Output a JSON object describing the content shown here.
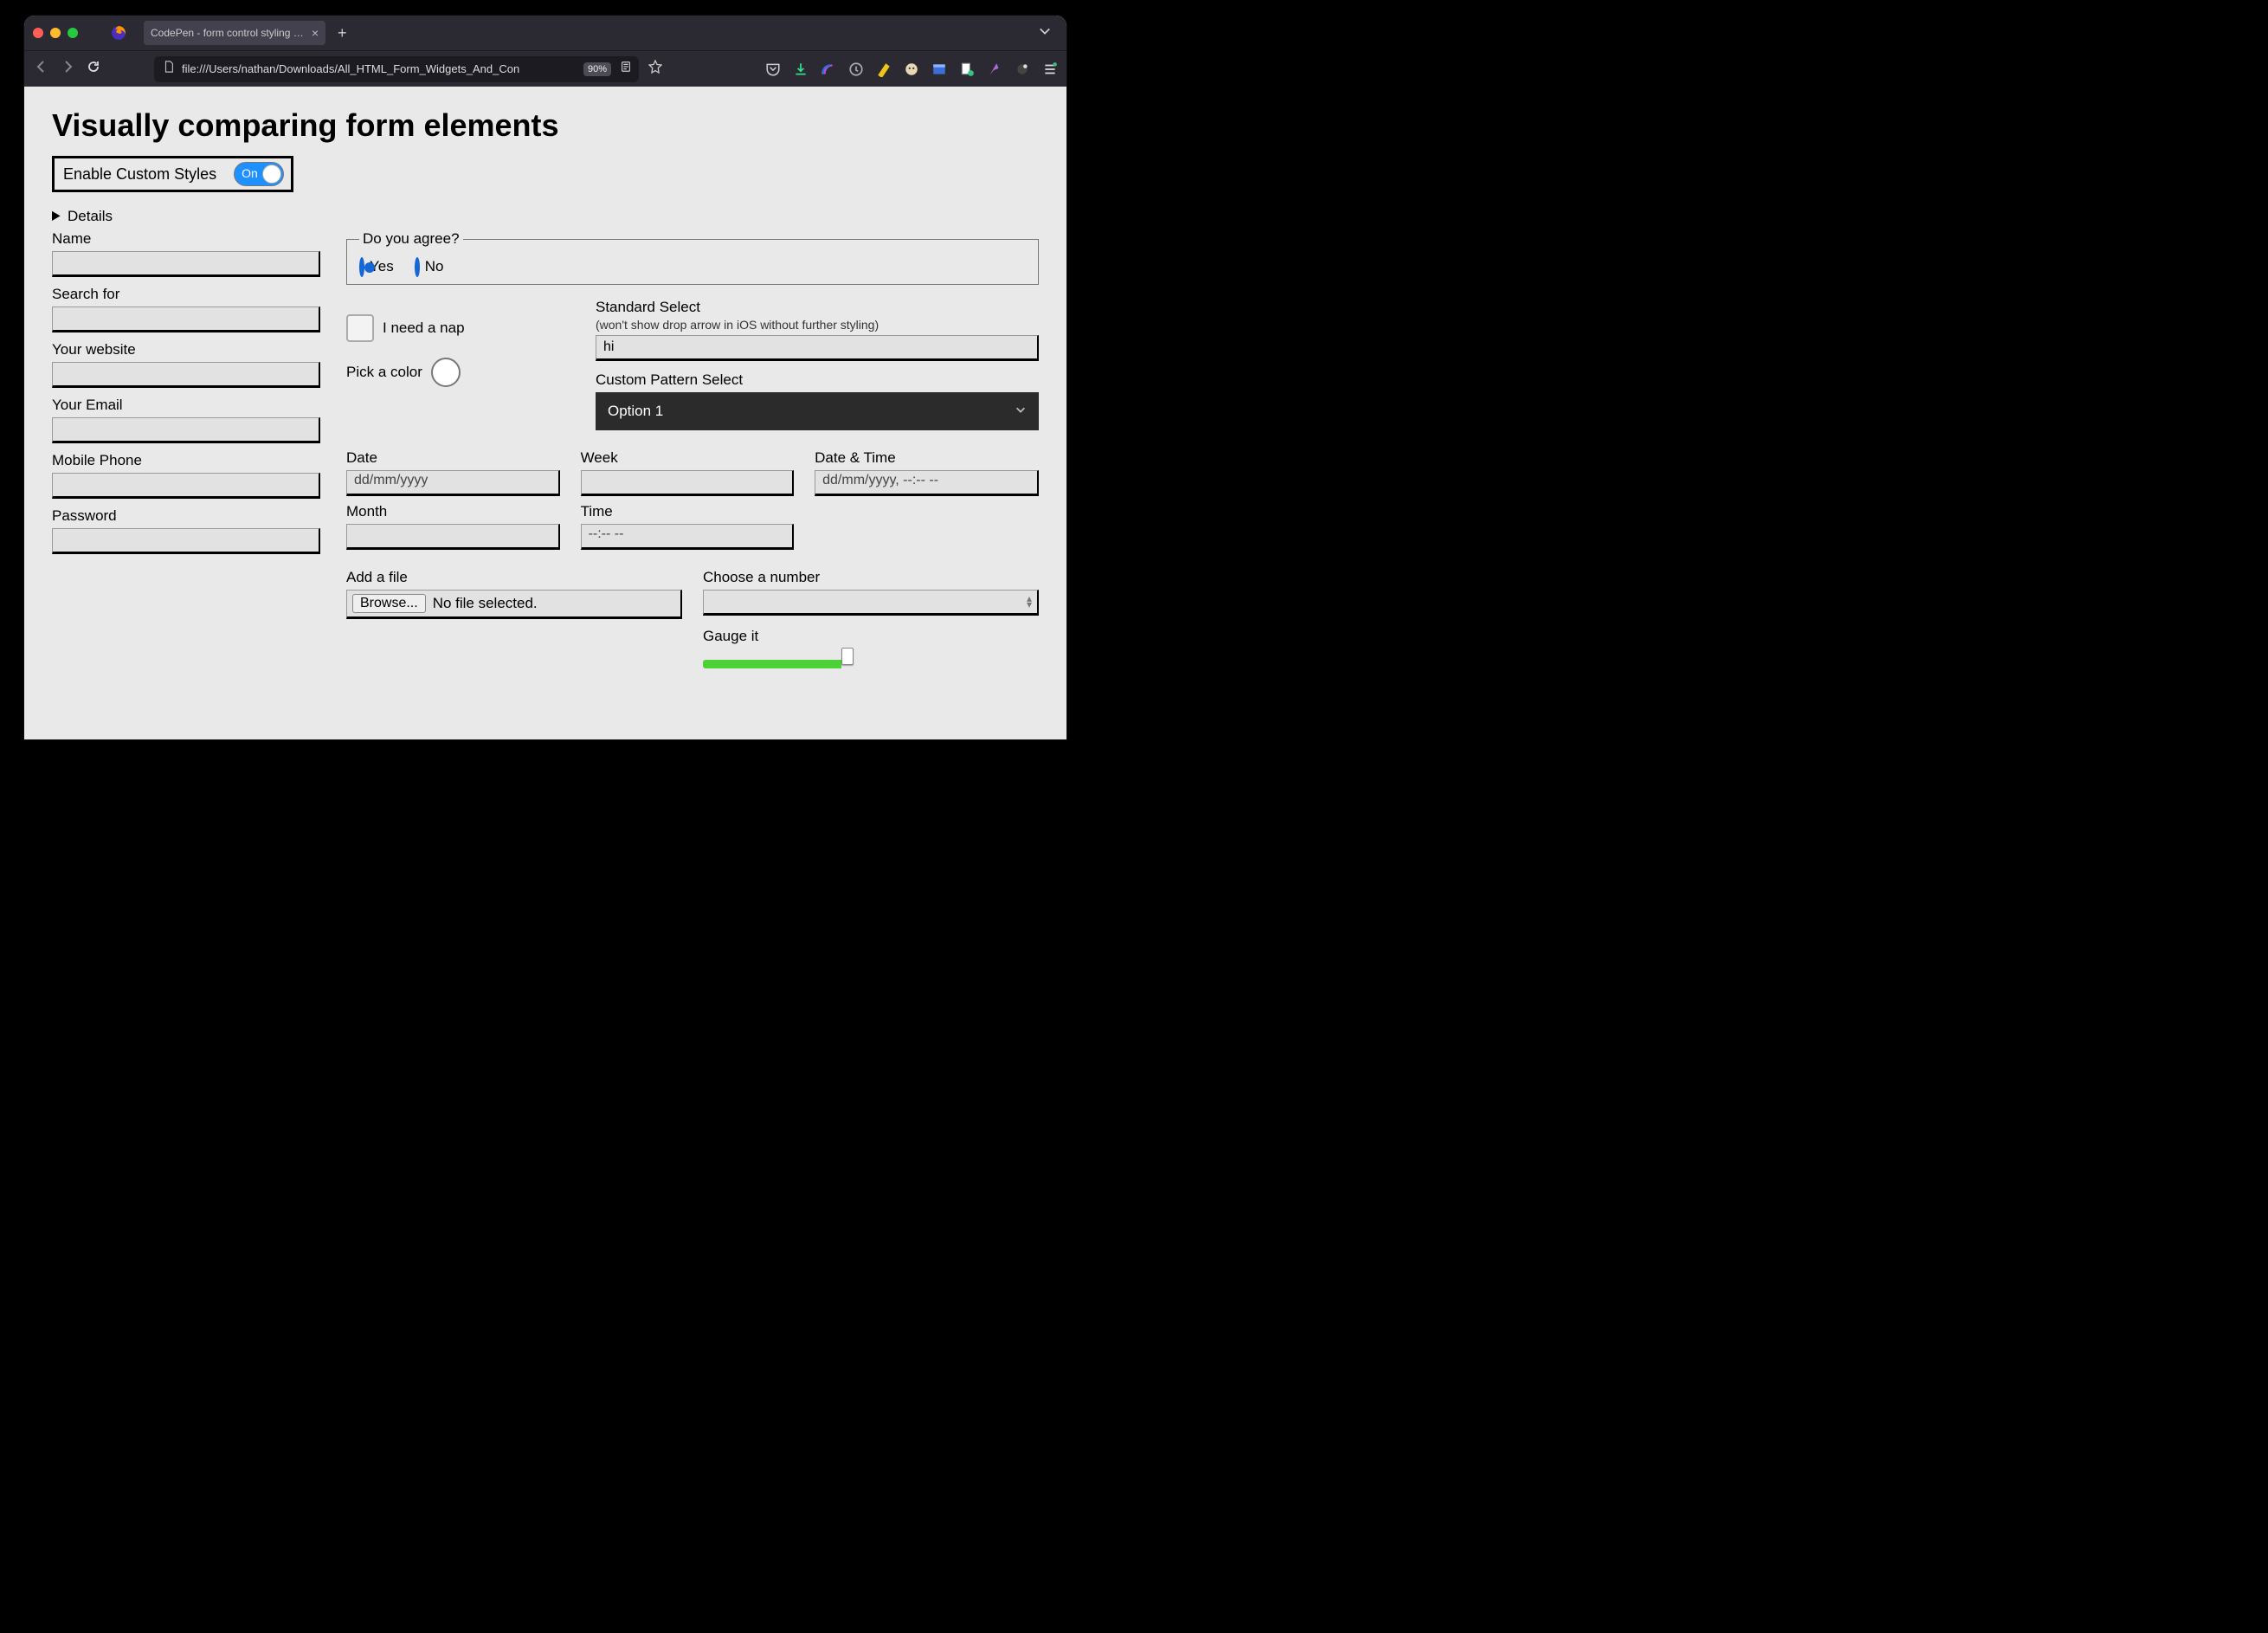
{
  "browser": {
    "tab_title": "CodePen - form control styling comp",
    "url": "file:///Users/nathan/Downloads/All_HTML_Form_Widgets_And_Con",
    "zoom": "90%"
  },
  "page": {
    "title": "Visually comparing form elements",
    "toggle_label": "Enable Custom Styles",
    "toggle_state": "On",
    "details_label": "Details",
    "left_fields": {
      "name": "Name",
      "search": "Search for",
      "website": "Your website",
      "email": "Your Email",
      "phone": "Mobile Phone",
      "password": "Password"
    },
    "agree": {
      "legend": "Do you agree?",
      "yes": "Yes",
      "no": "No"
    },
    "nap_label": "I need a nap",
    "color_label": "Pick a color",
    "select": {
      "std_label": "Standard Select",
      "std_hint": "(won't show drop arrow in iOS without further styling)",
      "std_value": "hi",
      "custom_label": "Custom Pattern Select",
      "custom_value": "Option 1"
    },
    "dt": {
      "date_label": "Date",
      "date_ph": "dd/mm/yyyy",
      "week_label": "Week",
      "datetime_label": "Date & Time",
      "datetime_ph": "dd/mm/yyyy, --:-- --",
      "month_label": "Month",
      "time_label": "Time",
      "time_ph": "--:-- --"
    },
    "file": {
      "label": "Add a file",
      "button": "Browse...",
      "status": "No file selected."
    },
    "number_label": "Choose a number",
    "gauge_label": "Gauge it"
  }
}
